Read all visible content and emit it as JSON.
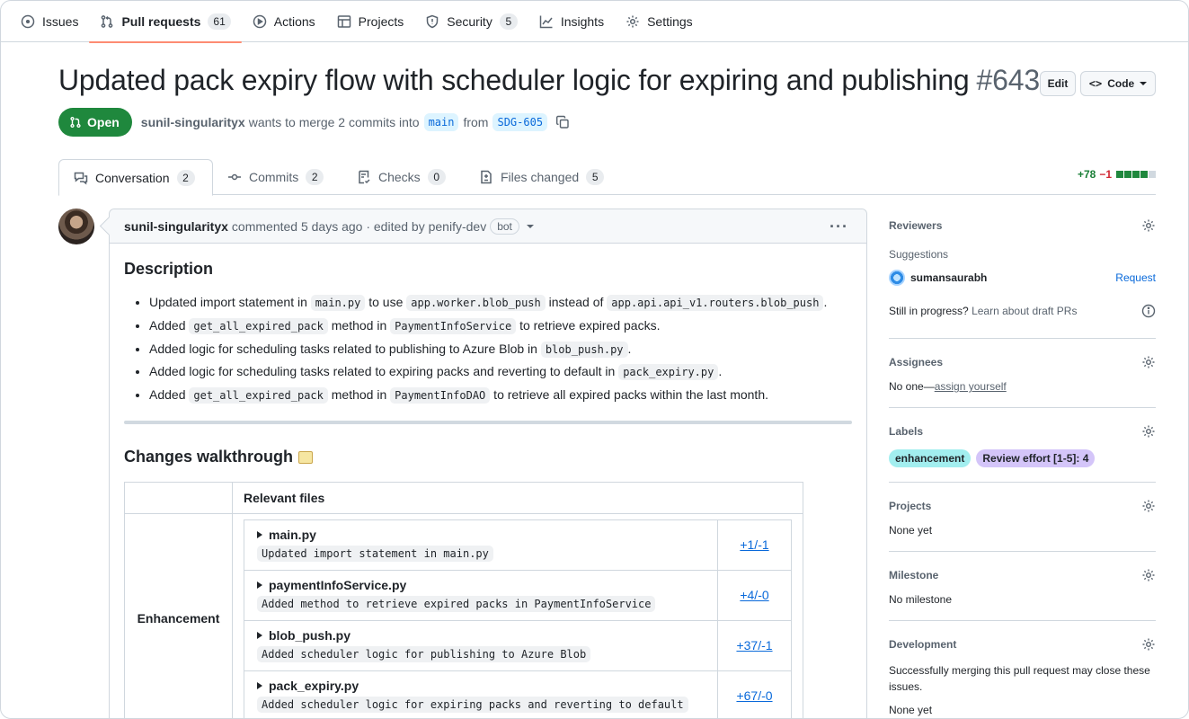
{
  "nav": {
    "items": [
      {
        "label": "Issues",
        "icon": "issue-opened-icon"
      },
      {
        "label": "Pull requests",
        "icon": "git-pull-request-icon",
        "count": "61",
        "active": true
      },
      {
        "label": "Actions",
        "icon": "play-icon"
      },
      {
        "label": "Projects",
        "icon": "table-icon"
      },
      {
        "label": "Security",
        "icon": "shield-icon",
        "count": "5"
      },
      {
        "label": "Insights",
        "icon": "graph-icon"
      },
      {
        "label": "Settings",
        "icon": "gear-icon"
      }
    ]
  },
  "pr": {
    "title": "Updated pack expiry flow with scheduler logic for expiring and publishing",
    "number": "#643",
    "edit_label": "Edit",
    "code_label": "Code",
    "state": "Open",
    "author": "sunil-singularityx",
    "merge_text": "wants to merge 2 commits into",
    "base_branch": "main",
    "from_text": "from",
    "head_branch": "SDG-605"
  },
  "tabs": [
    {
      "label": "Conversation",
      "count": "2",
      "icon": "comment-discussion-icon"
    },
    {
      "label": "Commits",
      "count": "2",
      "icon": "git-commit-icon"
    },
    {
      "label": "Checks",
      "count": "0",
      "icon": "checklist-icon"
    },
    {
      "label": "Files changed",
      "count": "5",
      "icon": "file-diff-icon"
    }
  ],
  "diffstat": {
    "additions": "+78",
    "deletions": "−1",
    "blocks": [
      "green",
      "green",
      "green",
      "green",
      "gray"
    ]
  },
  "comment": {
    "author": "sunil-singularityx",
    "meta": "commented 5 days ago · edited by penify-dev",
    "bot_label": "bot",
    "description_heading": "Description",
    "bullets": [
      [
        {
          "t": "Updated import statement in "
        },
        {
          "c": "main.py"
        },
        {
          "t": " to use "
        },
        {
          "c": "app.worker.blob_push"
        },
        {
          "t": " instead of "
        },
        {
          "c": "app.api.api_v1.routers.blob_push"
        },
        {
          "t": "."
        }
      ],
      [
        {
          "t": "Added "
        },
        {
          "c": "get_all_expired_pack"
        },
        {
          "t": " method in "
        },
        {
          "c": "PaymentInfoService"
        },
        {
          "t": " to retrieve expired packs."
        }
      ],
      [
        {
          "t": "Added logic for scheduling tasks related to publishing to Azure Blob in "
        },
        {
          "c": "blob_push.py"
        },
        {
          "t": "."
        }
      ],
      [
        {
          "t": "Added logic for scheduling tasks related to expiring packs and reverting to default in "
        },
        {
          "c": "pack_expiry.py"
        },
        {
          "t": "."
        }
      ],
      [
        {
          "t": "Added "
        },
        {
          "c": "get_all_expired_pack"
        },
        {
          "t": " method in "
        },
        {
          "c": "PaymentInfoDAO"
        },
        {
          "t": " to retrieve all expired packs within the last month."
        }
      ]
    ],
    "walkthrough_heading": "Changes walkthrough",
    "table_header": "Relevant files",
    "category": "Enhancement",
    "files": [
      {
        "name": "main.py",
        "desc": "Updated import statement in main.py",
        "changes": "+1/-1"
      },
      {
        "name": "paymentInfoService.py",
        "desc": "Added method to retrieve expired packs in PaymentInfoService",
        "changes": "+4/-0"
      },
      {
        "name": "blob_push.py",
        "desc": "Added scheduler logic for publishing to Azure Blob",
        "changes": "+37/-1"
      },
      {
        "name": "pack_expiry.py",
        "desc": "Added scheduler logic for expiring packs and reverting to default",
        "changes": "+67/-0"
      }
    ]
  },
  "sidebar": {
    "reviewers": {
      "title": "Reviewers",
      "suggestions": "Suggestions",
      "suggested_user": "sumansaurabh",
      "request": "Request",
      "draft_text": "Still in progress?",
      "draft_link": "Learn about draft PRs"
    },
    "assignees": {
      "title": "Assignees",
      "none": "No one—",
      "assign": "assign yourself"
    },
    "labels": {
      "title": "Labels",
      "items": [
        {
          "text": "enhancement",
          "color": "#a2eeef"
        },
        {
          "text": "Review effort [1-5]: 4",
          "color": "#d4c5f9"
        }
      ]
    },
    "projects": {
      "title": "Projects",
      "value": "None yet"
    },
    "milestone": {
      "title": "Milestone",
      "value": "No milestone"
    },
    "development": {
      "title": "Development",
      "text": "Successfully merging this pull request may close these issues.",
      "value": "None yet"
    }
  }
}
